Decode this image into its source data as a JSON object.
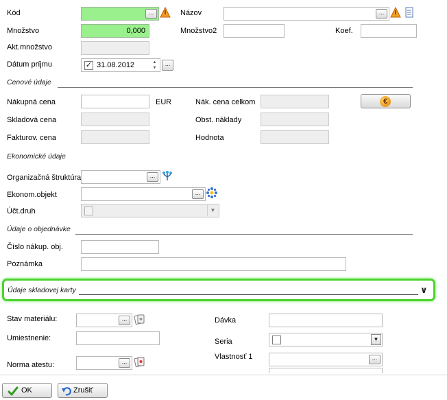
{
  "fields": {
    "kod": {
      "label": "Kód",
      "value": ""
    },
    "nazov": {
      "label": "Názov",
      "value": ""
    },
    "mnozstvo": {
      "label": "Množstvo",
      "value": "0,000"
    },
    "mnozstvo2": {
      "label": "Množstvo2",
      "value": ""
    },
    "koef": {
      "label": "Koef.",
      "value": ""
    },
    "akt_mnozstvo": {
      "label": "Akt.množstvo",
      "value": ""
    },
    "datum_prijmu": {
      "label": "Dátum príjmu",
      "value": "31.08.2012",
      "checked": true
    }
  },
  "cenove": {
    "section_title": "Cenové údaje",
    "nakupna_cena": {
      "label": "Nákupná cena",
      "value": "",
      "currency": "EUR"
    },
    "skladova_cena": {
      "label": "Skladová cena",
      "value": ""
    },
    "fakturov_cena": {
      "label": "Fakturov. cena",
      "value": ""
    },
    "nak_cena_celkom": {
      "label": "Nák. cena celkom",
      "value": ""
    },
    "obst_naklady": {
      "label": "Obst. náklady",
      "value": ""
    },
    "hodnota": {
      "label": "Hodnota",
      "value": ""
    },
    "euro_button_symbol": "€"
  },
  "ekonomicke": {
    "section_title": "Ekonomické údaje",
    "org_struktura": {
      "label": "Organizačná štruktúra",
      "value": ""
    },
    "ekonom_objekt": {
      "label": "Ekonom.objekt",
      "value": ""
    },
    "uct_druh": {
      "label": "Účt.druh",
      "value": "",
      "checked": false
    }
  },
  "objednavka": {
    "section_title": "Údaje o objednávke",
    "cislo_nakup_obj": {
      "label": "Číslo nákup. obj.",
      "value": ""
    },
    "poznamka": {
      "label": "Poznámka",
      "value": ""
    }
  },
  "skladova_karta": {
    "section_title": "Údaje skladovej karty",
    "highlight_color": "#4cd32e",
    "stav_materialu": {
      "label": "Stav materiálu:",
      "value": ""
    },
    "umiestnenie": {
      "label": "Umiestnenie:",
      "value": ""
    },
    "norma_atestu": {
      "label": "Norma atestu:",
      "value": ""
    },
    "davka": {
      "label": "Dávka",
      "value": ""
    },
    "seria": {
      "label": "Seria",
      "value": "",
      "checked": false
    },
    "vlastnost1": {
      "label": "Vlastnosť 1",
      "value": ""
    }
  },
  "footer": {
    "ok_label": "OK",
    "cancel_label": "Zrušiť"
  },
  "common": {
    "ellipsis": "...",
    "spin_up": "▲",
    "spin_down": "▼",
    "dropdown_arrow": "▼",
    "collapse_chevron": "∨",
    "check_mark": "✓"
  },
  "colors": {
    "required_field": "#9af08c",
    "readonly_field": "#eeeeee",
    "ok_check": "#2e9a1e"
  },
  "icons": {
    "kod_lookup": "warning-triangle-icon",
    "nazov_lookup": "warning-triangle-icon",
    "nazov_doc": "document-icon",
    "org_struktura": "tree-structure-icon",
    "ekonom_objekt": "network-icon",
    "stav_materialu": "cards-icon",
    "norma_atestu": "cards-icon",
    "ok": "checkmark-icon",
    "cancel": "undo-arrow-icon"
  }
}
